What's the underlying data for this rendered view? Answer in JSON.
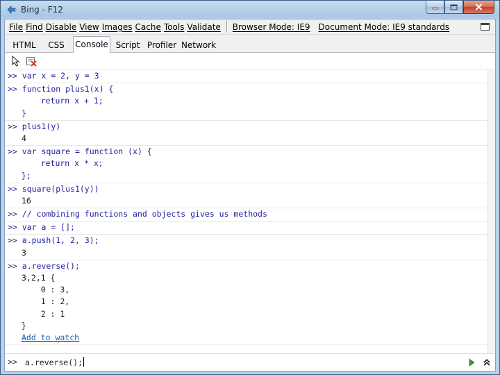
{
  "window": {
    "title": "Bing - F12"
  },
  "menu": {
    "items": [
      "File",
      "Find",
      "Disable",
      "View",
      "Images",
      "Cache",
      "Tools",
      "Validate"
    ],
    "browser_mode": "Browser Mode: IE9",
    "document_mode": "Document Mode: IE9 standards"
  },
  "tabs": [
    {
      "label": "HTML",
      "active": false
    },
    {
      "label": "CSS",
      "active": false
    },
    {
      "label": "Console",
      "active": true
    },
    {
      "label": "Script",
      "active": false
    },
    {
      "label": "Profiler",
      "active": false
    },
    {
      "label": "Network",
      "active": false
    }
  ],
  "toolbar": {
    "icons": [
      "select-element-icon",
      "clear-console-icon"
    ]
  },
  "console": {
    "prompt_marker": ">>",
    "entries": [
      {
        "lines": [
          {
            "kind": "prompt",
            "text": "var x = 2, y = 3"
          }
        ]
      },
      {
        "lines": [
          {
            "kind": "prompt",
            "text": "function plus1(x) {"
          },
          {
            "kind": "cont",
            "text": "    return x + 1;"
          },
          {
            "kind": "cont",
            "text": "}"
          }
        ]
      },
      {
        "lines": [
          {
            "kind": "prompt",
            "text": "plus1(y)"
          },
          {
            "kind": "result",
            "text": "4"
          }
        ]
      },
      {
        "lines": [
          {
            "kind": "prompt",
            "text": "var square = function (x) {"
          },
          {
            "kind": "cont",
            "text": "    return x * x;"
          },
          {
            "kind": "cont",
            "text": "};"
          }
        ]
      },
      {
        "lines": [
          {
            "kind": "prompt",
            "text": "square(plus1(y))"
          },
          {
            "kind": "result",
            "text": "16"
          }
        ]
      },
      {
        "lines": [
          {
            "kind": "prompt",
            "text": "// combining functions and objects gives us methods"
          }
        ]
      },
      {
        "lines": [
          {
            "kind": "prompt",
            "text": "var a = [];"
          }
        ]
      },
      {
        "lines": [
          {
            "kind": "prompt",
            "text": "a.push(1, 2, 3);"
          },
          {
            "kind": "result",
            "text": "3"
          }
        ]
      },
      {
        "lines": [
          {
            "kind": "prompt",
            "text": "a.reverse();"
          },
          {
            "kind": "result",
            "text": "3,2,1 {"
          },
          {
            "kind": "result",
            "text": "    0 : 3,"
          },
          {
            "kind": "result",
            "text": "    1 : 2,"
          },
          {
            "kind": "result",
            "text": "    2 : 1"
          },
          {
            "kind": "result",
            "text": "}"
          },
          {
            "kind": "link",
            "text": "Add to watch"
          }
        ]
      }
    ]
  },
  "input": {
    "prompt": ">>",
    "value": "a.reverse();"
  },
  "colors": {
    "code": "#1f1f9e",
    "result": "#1a1a1a",
    "link": "#1c5fb8",
    "run_icon": "#2c9a2c"
  }
}
